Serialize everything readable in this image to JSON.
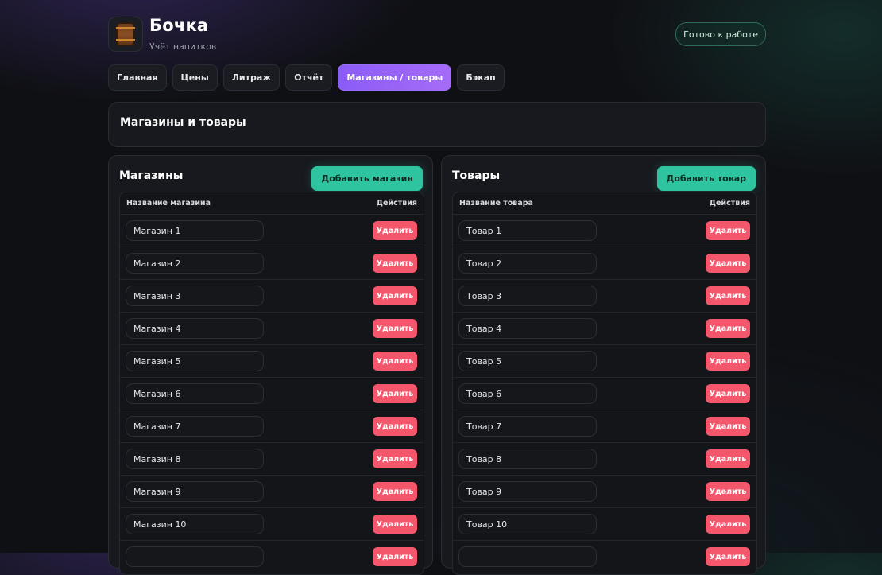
{
  "app": {
    "title": "Бочка",
    "subtitle": "Учёт напитков",
    "status": "Готово к работе",
    "logo_icon": "barrel-icon"
  },
  "tabs": [
    {
      "label": "Главная",
      "active": false
    },
    {
      "label": "Цены",
      "active": false
    },
    {
      "label": "Литраж",
      "active": false
    },
    {
      "label": "Отчёт",
      "active": false
    },
    {
      "label": "Магазины / товары",
      "active": true
    },
    {
      "label": "Бэкап",
      "active": false
    }
  ],
  "section": {
    "title": "Магазины и товары"
  },
  "stores": {
    "title": "Магазины",
    "add_label": "Добавить магазин",
    "col_name": "Название магазина",
    "col_actions": "Действия",
    "delete_label": "Удалить",
    "items": [
      "Магазин 1",
      "Магазин 2",
      "Магазин 3",
      "Магазин 4",
      "Магазин 5",
      "Магазин 6",
      "Магазин 7",
      "Магазин 8",
      "Магазин 9",
      "Магазин 10",
      ""
    ]
  },
  "products": {
    "title": "Товары",
    "add_label": "Добавить товар",
    "col_name": "Название товара",
    "col_actions": "Действия",
    "delete_label": "Удалить",
    "items": [
      "Товар 1",
      "Товар 2",
      "Товар 3",
      "Товар 4",
      "Товар 5",
      "Товар 6",
      "Товар 7",
      "Товар 8",
      "Товар 9",
      "Товар 10",
      ""
    ]
  },
  "colors": {
    "accent_purple": "#8b5cf6",
    "accent_green": "#2ec4a0",
    "danger": "#f4566b",
    "background": "#0f1014"
  }
}
